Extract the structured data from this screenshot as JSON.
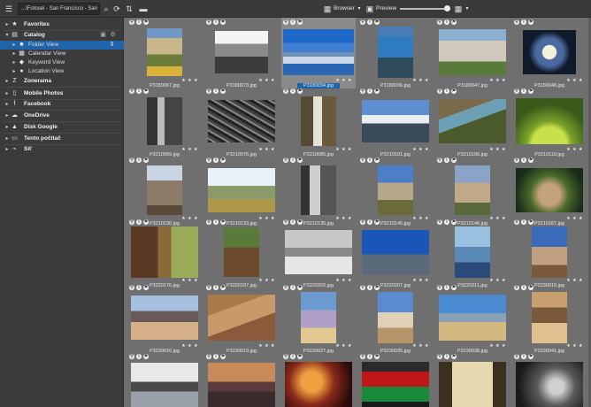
{
  "toolbar": {
    "path": "...\\Fotosel - San Francisco - San Kup",
    "browser_label": "Browser",
    "preview_label": "Preview"
  },
  "sidebar": {
    "items": [
      {
        "label": "Favorites",
        "icon": "star-icon",
        "level": 0,
        "expanded": false
      },
      {
        "label": "Catalog",
        "icon": "catalog-icon",
        "level": 0,
        "expanded": true
      },
      {
        "label": "Folder View",
        "icon": "folder-icon",
        "level": 1,
        "selected": true
      },
      {
        "label": "Calendar View",
        "icon": "calendar-icon",
        "level": 1
      },
      {
        "label": "Keyword View",
        "icon": "keyword-icon",
        "level": 1
      },
      {
        "label": "Location View",
        "icon": "location-icon",
        "level": 1
      },
      {
        "label": "Zonerama",
        "icon": "zonerama-icon",
        "level": 0
      },
      {
        "label": "Mobile Photos",
        "icon": "phone-icon",
        "level": 0
      },
      {
        "label": "Facebook",
        "icon": "facebook-icon",
        "level": 0
      },
      {
        "label": "OneDrive",
        "icon": "cloud-icon",
        "level": 0
      },
      {
        "label": "Disk Google",
        "icon": "drive-icon",
        "level": 0
      },
      {
        "label": "Tento počítač",
        "icon": "computer-icon",
        "level": 0
      },
      {
        "label": "Síť",
        "icon": "network-icon",
        "level": 0
      }
    ]
  },
  "photos": [
    {
      "name": "P3180067.jpg"
    },
    {
      "name": "P3180073.jpg"
    },
    {
      "name": "P3180034.jpg",
      "selected": true
    },
    {
      "name": "P3180036.jpg"
    },
    {
      "name": "P3180047.jpg"
    },
    {
      "name": "P3180048.jpg"
    },
    {
      "name": "P3210069.jpg"
    },
    {
      "name": "P3210076.jpg"
    },
    {
      "name": "P3210085.jpg"
    },
    {
      "name": "P3210101.jpg"
    },
    {
      "name": "P3210106.jpg"
    },
    {
      "name": "P3210110.jpg"
    },
    {
      "name": "P3210130.jpg"
    },
    {
      "name": "P3210133.jpg"
    },
    {
      "name": "P3210135.jpg"
    },
    {
      "name": "P3210140.jpg"
    },
    {
      "name": "P3210146.jpg"
    },
    {
      "name": "P3210167.jpg"
    },
    {
      "name": "P3220176.jpg"
    },
    {
      "name": "P3220187.jpg"
    },
    {
      "name": "P3220203.jpg"
    },
    {
      "name": "P3220207.jpg"
    },
    {
      "name": "P3220211.jpg"
    },
    {
      "name": "P3230010.jpg"
    },
    {
      "name": "P3230016.jpg"
    },
    {
      "name": "P3230019.jpg"
    },
    {
      "name": "P3230027.jpg"
    },
    {
      "name": "P3230035.jpg"
    },
    {
      "name": "P3230038.jpg"
    },
    {
      "name": "P3230041.jpg"
    },
    {
      "name": ""
    },
    {
      "name": ""
    },
    {
      "name": ""
    },
    {
      "name": ""
    },
    {
      "name": ""
    },
    {
      "name": ""
    }
  ],
  "colors": {
    "accent": "#1f63a8",
    "sidebar_bg": "#3b3b3b",
    "grid_bg": "#6f6f6f"
  }
}
